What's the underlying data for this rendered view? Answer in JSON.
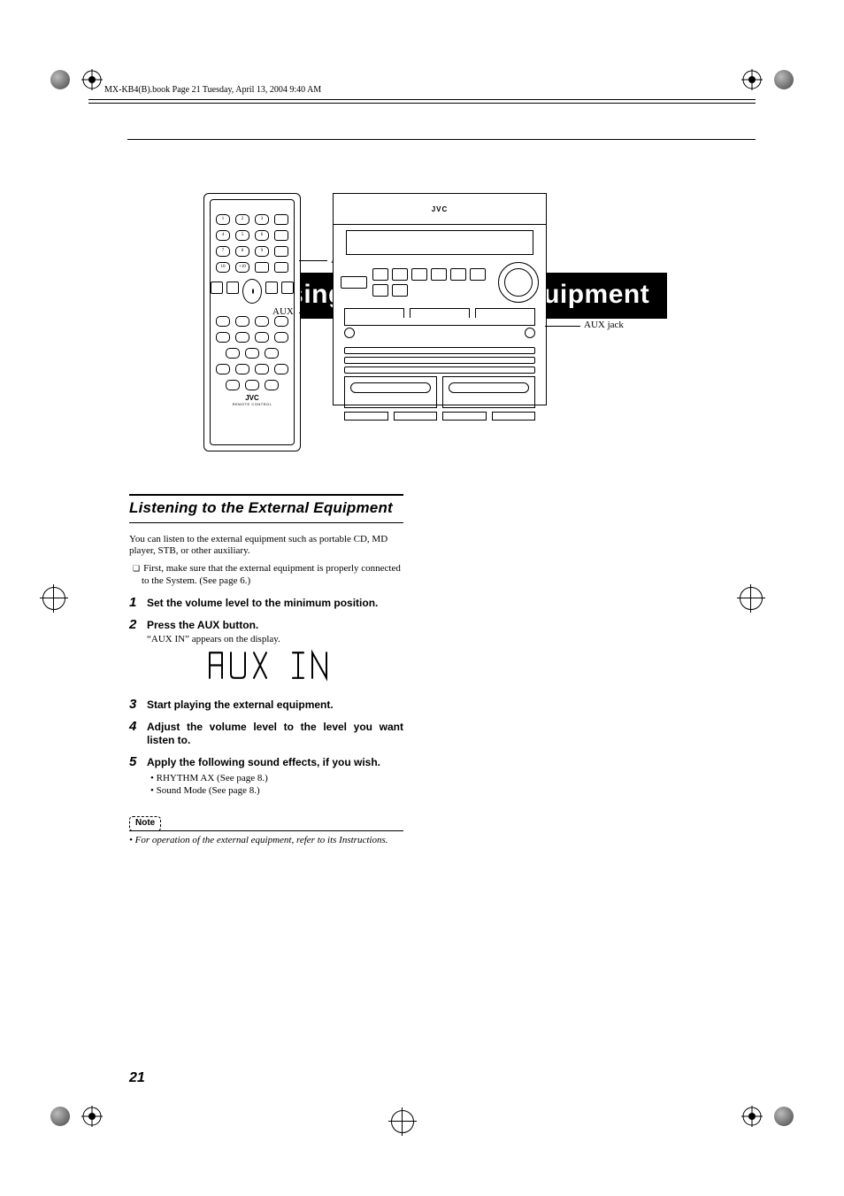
{
  "running_head": "MX-KB4(B).book  Page 21  Tuesday, April 13, 2004  9:40 AM",
  "title": "Using an External Equipment",
  "leaders": {
    "remote_aux": "AUX",
    "unit_aux": "AUX",
    "aux_jack": "AUX jack"
  },
  "diagram": {
    "remote_brand": "JVC",
    "remote_sub": "REMOTE CONTROL",
    "unit_brand": "JVC"
  },
  "section_heading": "Listening to the External Equipment",
  "intro": "You can listen to the external equipment such as portable CD, MD player, STB, or other auxiliary.",
  "first_note": "First, make sure that the external equipment is properly connected to the System. (See page 6.)",
  "steps": [
    {
      "n": "1",
      "title": "Set the volume level to the minimum position."
    },
    {
      "n": "2",
      "title": "Press the AUX button.",
      "body": "“AUX IN” appears on the display."
    },
    {
      "n": "3",
      "title": "Start playing the external equipment."
    },
    {
      "n": "4",
      "title": "Adjust the volume level to the level you want listen to."
    },
    {
      "n": "5",
      "title": "Apply the following sound effects, if you wish.",
      "bullets": [
        "RHYTHM AX (See page 8.)",
        "Sound Mode (See page 8.)"
      ]
    }
  ],
  "seg_display": "AUX  IN",
  "note_label": "Note",
  "note_body": "For operation of the external equipment, refer to its Instructions.",
  "page_number": "21"
}
